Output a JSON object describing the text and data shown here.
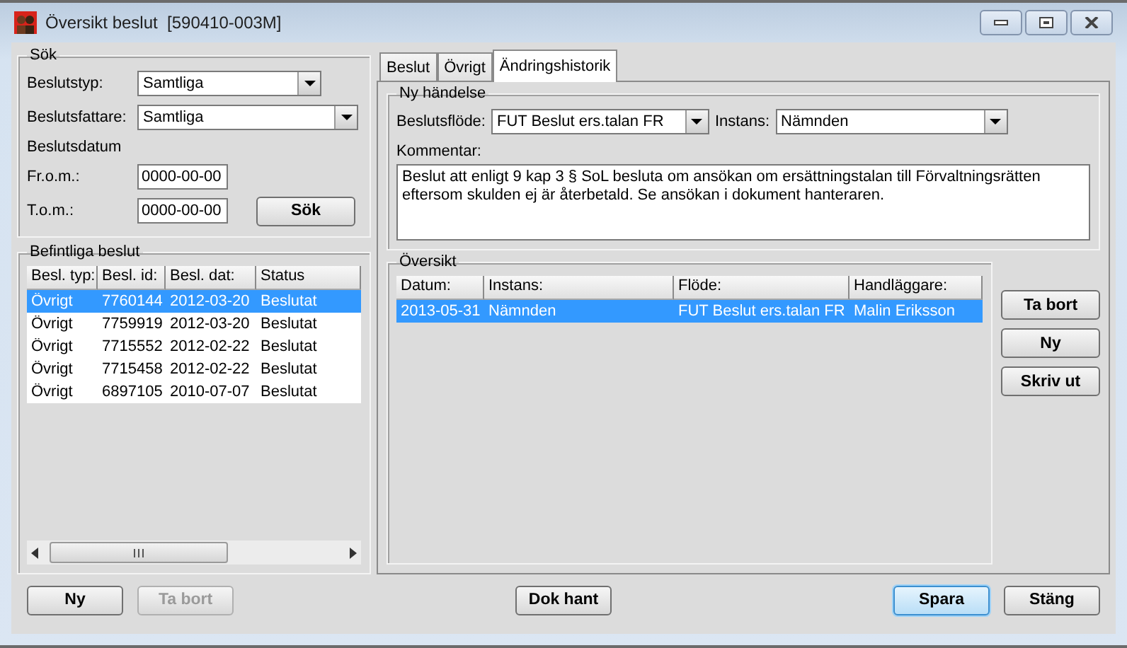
{
  "window": {
    "title": "Översikt beslut  [590410-003M]"
  },
  "search": {
    "title": "Sök",
    "selects": [
      {
        "label": "Beslutstyp:",
        "value": "Samtliga",
        "wide": false
      },
      {
        "label": "Beslutsfattare:",
        "value": "Samtliga",
        "wide": true
      }
    ],
    "date_heading": "Beslutsdatum",
    "dates": [
      {
        "label": "Fr.o.m.:",
        "value": "0000-00-00"
      },
      {
        "label": "T.o.m.:",
        "value": "0000-00-00"
      }
    ],
    "button": "Sök"
  },
  "existing": {
    "title": "Befintliga beslut",
    "columns": [
      "Besl. typ:",
      "Besl. id:",
      "Besl. dat:",
      "Status"
    ],
    "rows": [
      {
        "cells": [
          "Övrigt",
          "7760144",
          "2012-03-20",
          "Beslutat"
        ],
        "selected": true
      },
      {
        "cells": [
          "Övrigt",
          "7759919",
          "2012-03-20",
          "Beslutat"
        ],
        "selected": false
      },
      {
        "cells": [
          "Övrigt",
          "7715552",
          "2012-02-22",
          "Beslutat"
        ],
        "selected": false
      },
      {
        "cells": [
          "Övrigt",
          "7715458",
          "2012-02-22",
          "Beslutat"
        ],
        "selected": false
      },
      {
        "cells": [
          "Övrigt",
          "6897105",
          "2010-07-07",
          "Beslutat"
        ],
        "selected": false
      }
    ]
  },
  "tabs": [
    {
      "label": "Beslut",
      "selected": false
    },
    {
      "label": "Övrigt",
      "selected": false
    },
    {
      "label": "Ändringshistorik",
      "selected": true
    }
  ],
  "new_event": {
    "title": "Ny händelse",
    "flow": {
      "label": "Beslutsflöde:",
      "value": "FUT Beslut ers.talan FR"
    },
    "instance": {
      "label": "Instans:",
      "value": "Nämnden"
    },
    "comment": {
      "label": "Kommentar:",
      "value": "Beslut att enligt 9 kap 3 § SoL besluta om ansökan om ersättningstalan till Förvaltningsrätten eftersom skulden ej är återbetald. Se ansökan i dokument hanteraren."
    }
  },
  "overview": {
    "title": "Översikt",
    "columns": [
      "Datum:",
      "Instans:",
      "Flöde:",
      "Handläggare:"
    ],
    "rows": [
      {
        "cells": [
          "2013-05-31",
          "Nämnden",
          "FUT Beslut ers.talan FR",
          "Malin Eriksson"
        ],
        "selected": true
      }
    ]
  },
  "side_buttons": [
    "Ta bort",
    "Ny",
    "Skriv ut"
  ],
  "footer_buttons": [
    {
      "label": "Ny",
      "disabled": false,
      "focused": false
    },
    {
      "label": "Ta bort",
      "disabled": true,
      "focused": false
    },
    {
      "label": "Dok hant",
      "disabled": false,
      "focused": false
    },
    {
      "label": "Spara",
      "disabled": false,
      "focused": true
    },
    {
      "label": "Stäng",
      "disabled": false,
      "focused": false
    }
  ]
}
